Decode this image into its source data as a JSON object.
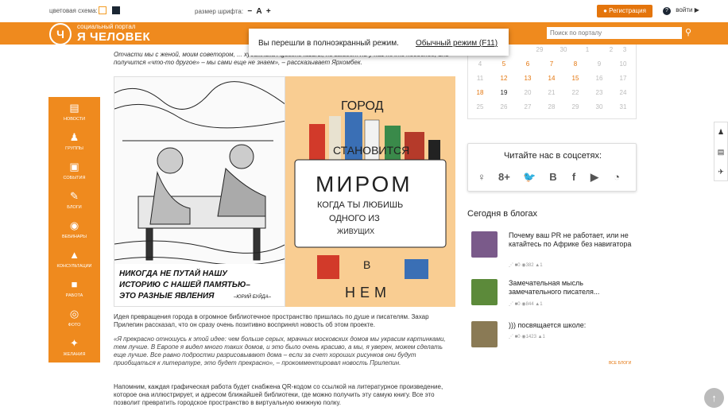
{
  "topbar": {
    "color_scheme_label": "цветовая схема:",
    "font_size_label": "размер шрифта:",
    "font_minus": "−",
    "font_a": "A",
    "font_plus": "+",
    "register": "Регистрация",
    "login": "войти",
    "help_icon": "question-icon"
  },
  "header": {
    "logo_small": "социальный портал",
    "logo_big": "Я ЧЕЛОВЕК",
    "search_placeholder": "Поиск по порталу"
  },
  "fullscreen_notice": {
    "text": "Вы перешли в полноэкранный режим.",
    "link": "Обычный режим (F11)"
  },
  "sidenav": [
    {
      "label": "новости",
      "icon": "newspaper-icon"
    },
    {
      "label": "группы",
      "icon": "people-icon"
    },
    {
      "label": "события",
      "icon": "calendar-icon"
    },
    {
      "label": "блоги",
      "icon": "pencil-icon"
    },
    {
      "label": "вебинары",
      "icon": "webinar-icon"
    },
    {
      "label": "консультации",
      "icon": "graduation-cap-icon"
    },
    {
      "label": "работа",
      "icon": "briefcase-icon"
    },
    {
      "label": "фото",
      "icon": "camera-icon"
    },
    {
      "label": "желания",
      "icon": "magic-wand-icon"
    }
  ],
  "article": {
    "p0": "Отчасти мы с женой, моим советором, ... художника Agostino Iacurci, но выйдет ли у нас нечто подобное, или получится «что-то другое» – мы сами еще не знаем», – рассказывает Ярхомбек.",
    "p1": "Идея превращения города в огромное библиотечное пространство пришлась по душе и писателям. Захар Прилепин рассказал, что он сразу очень позитивно воспринял новость об этом проекте.",
    "p2": "«Я прекрасно отношусь к этой идее: чем больше серых, мрачных московских домов мы украсим картинками, тем лучше. В Европе я видел много таких домов, и это было очень красиво, а мы, я уверен, можем сделать еще лучше. Все равно подростки разрисовывают дома – если за счет хороших рисунков они будут приобщаться к литературе, это будет прекрасно», – прокомментировал новость Прилепин.",
    "p3": "Напомним, каждая графическая работа будет снабжена QR-кодом со ссылкой на литературное произведение, которое она иллюстрирует, и адресом ближайшей библиотеки, где можно получить эту самую книгу. Все это позволит превратить городское пространство в виртуальную книжную полку.",
    "illus_left_caption_1": "НИКОГДА НЕ ПУТАЙ НАШУ",
    "illus_left_caption_2": "ИСТОРИЮ С НАШЕЙ ПАМЯТЬЮ–",
    "illus_left_caption_3": "ЭТО РАЗНЫЕ ЯВЛЕНИЯ",
    "illus_left_author": "–ЮРИЙ БУЙДА–",
    "illus_right_1": "ГОРОД",
    "illus_right_2": "СТАНОВИТСЯ",
    "illus_right_3": "МИРОМ",
    "illus_right_4": "КОГДА ТЫ ЛЮБИШЬ",
    "illus_right_5": "ОДНОГО ИЗ",
    "illus_right_6": "ЖИВУЩИХ",
    "illus_right_7": "В",
    "illus_right_8": "НЕМ"
  },
  "calendar": {
    "rows": [
      [
        "",
        "",
        "",
        "",
        "",
        "",
        ""
      ],
      [
        "4",
        "5",
        "6",
        "7",
        "8",
        "9",
        "10"
      ],
      [
        "11",
        "12",
        "13",
        "14",
        "15",
        "16",
        "17"
      ],
      [
        "18",
        "19",
        "20",
        "21",
        "22",
        "23",
        "24"
      ],
      [
        "25",
        "26",
        "27",
        "28",
        "29",
        "30",
        "31"
      ]
    ],
    "top_row": [
      "",
      "",
      "29",
      "30",
      "1",
      "2",
      "3"
    ]
  },
  "social": {
    "title": "Читайте нас в соцсетях:",
    "icons": [
      "odnoklassniki-icon",
      "google-plus-icon",
      "twitter-icon",
      "vk-icon",
      "facebook-icon",
      "youtube-icon",
      "rss-icon"
    ],
    "glyphs": [
      "♀",
      "8+",
      "🐦",
      "B",
      "f",
      "▶",
      "◔"
    ]
  },
  "blogs": {
    "title": "Сегодня в блогах",
    "items": [
      {
        "text": "Почему ваш PR не работает, или не катайтесь по Африке без навигатора",
        "comments": "0",
        "views": "382",
        "likes": "1",
        "avatar_color": "#7a5a8a"
      },
      {
        "text": "Замечательная мысль замечательного писателя...",
        "comments": "0",
        "views": "844",
        "likes": "1",
        "avatar_color": "#5c8a3a"
      },
      {
        "text": "))) посвящается школе:",
        "comments": "0",
        "views": "1423",
        "likes": "1",
        "avatar_color": "#8a7a55"
      }
    ],
    "all_link": "все блоги"
  },
  "colors": {
    "accent": "#ef8a1e",
    "accent_dark": "#e4750c"
  }
}
